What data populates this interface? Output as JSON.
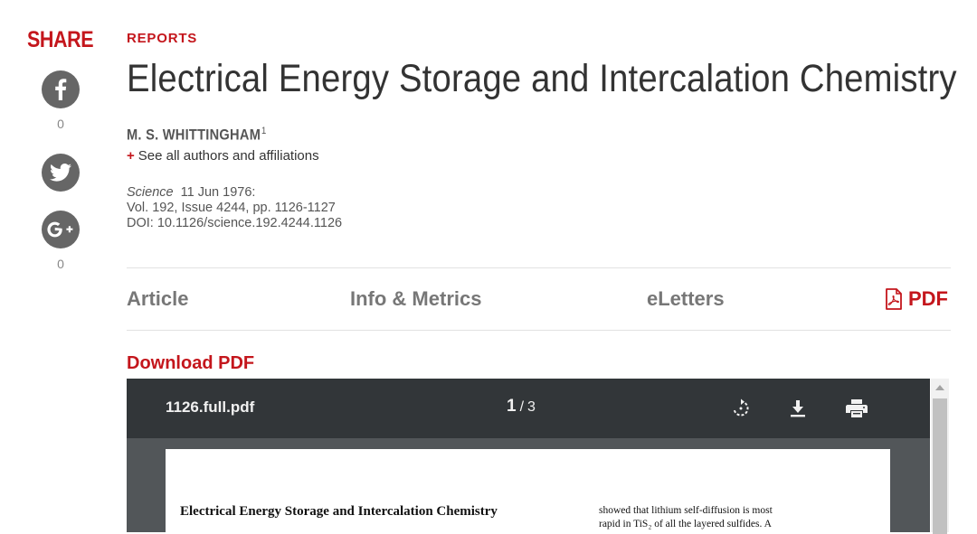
{
  "share": {
    "title": "SHARE",
    "facebook_count": "0",
    "googleplus_count": "0"
  },
  "article": {
    "section": "REPORTS",
    "title": "Electrical Energy Storage and Intercalation Chemistry",
    "author": "M. S. WHITTINGHAM",
    "author_affil_mark": "1",
    "affiliations_link": "See all authors and affiliations",
    "affiliations_plus": "+",
    "journal": "Science",
    "date": "11 Jun 1976:",
    "volume": "Vol. 192, Issue 4244, pp. 1126-1127",
    "doi": "DOI: 10.1126/science.192.4244.1126"
  },
  "tabs": {
    "article": "Article",
    "info": "Info & Metrics",
    "eletters": "eLetters",
    "pdf": "PDF"
  },
  "download_label": "Download PDF",
  "viewer": {
    "filename": "1126.full.pdf",
    "current_page": "1",
    "page_separator": "/",
    "total_pages": "3",
    "icons": [
      "rotate-icon",
      "download-icon",
      "print-icon"
    ]
  },
  "paper": {
    "title": "Electrical Energy Storage and Intercalation Chemistry",
    "col_line1": "showed that lithium self-diffusion is most",
    "col_line2": "rapid in TiS₂ of all the layered sulfides. A"
  },
  "colors": {
    "accent": "#c4161c",
    "toolbar": "#323639",
    "viewer_bg": "#525659",
    "social_icon_bg": "#666666"
  }
}
